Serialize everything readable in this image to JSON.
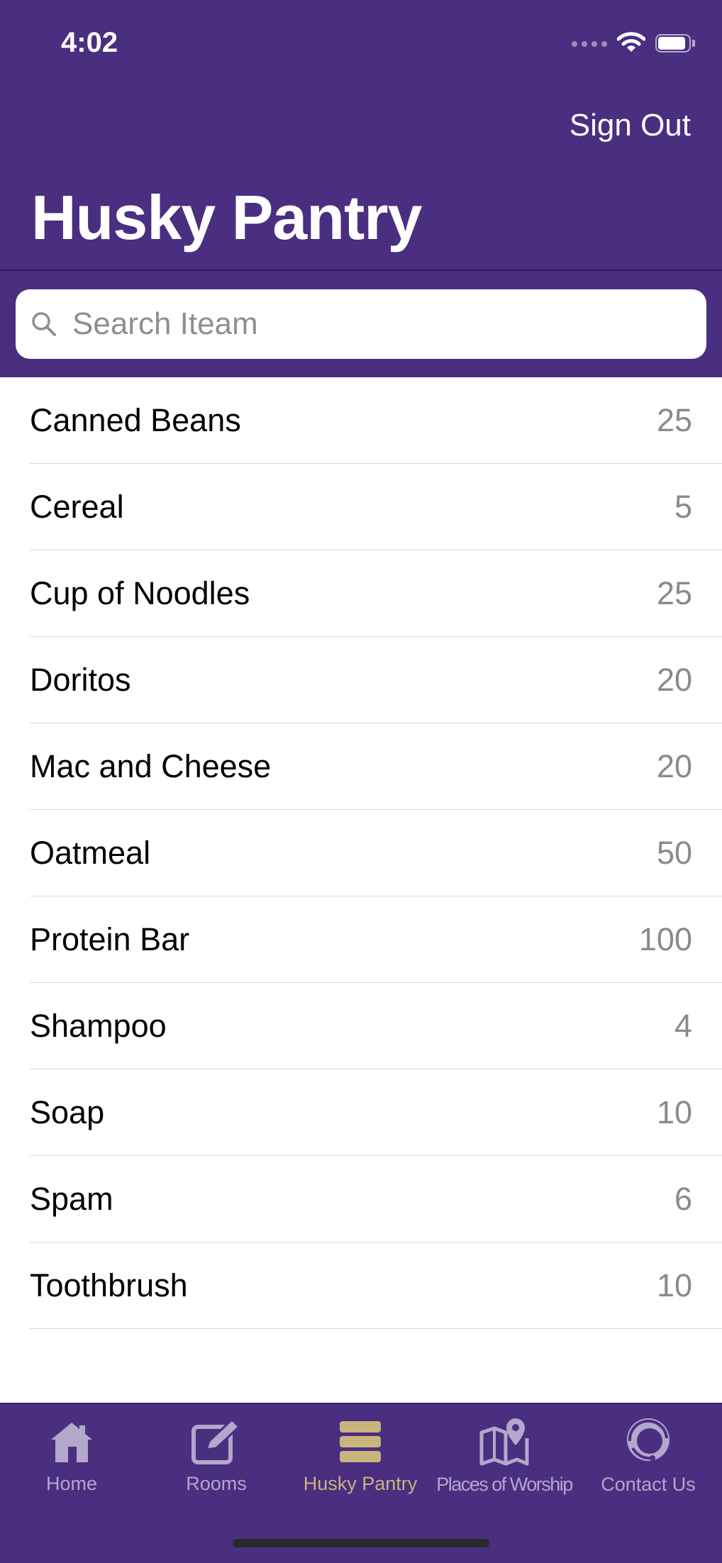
{
  "status_bar": {
    "time": "4:02"
  },
  "nav": {
    "sign_out_label": "Sign Out",
    "title": "Husky Pantry"
  },
  "search": {
    "placeholder": "Search Iteam",
    "value": ""
  },
  "items": [
    {
      "name": "Canned Beans",
      "count": "25"
    },
    {
      "name": "Cereal",
      "count": "5"
    },
    {
      "name": "Cup of Noodles",
      "count": "25"
    },
    {
      "name": "Doritos",
      "count": "20"
    },
    {
      "name": "Mac and Cheese",
      "count": "20"
    },
    {
      "name": "Oatmeal",
      "count": "50"
    },
    {
      "name": "Protein Bar",
      "count": "100"
    },
    {
      "name": "Shampoo",
      "count": "4"
    },
    {
      "name": "Soap",
      "count": "10"
    },
    {
      "name": "Spam",
      "count": "6"
    },
    {
      "name": "Toothbrush",
      "count": "10"
    }
  ],
  "tabbar": {
    "active": "Husky Pantry",
    "tabs": [
      {
        "label": "Home",
        "icon": "house-icon"
      },
      {
        "label": "Rooms",
        "icon": "compose-icon"
      },
      {
        "label": "Husky Pantry",
        "icon": "stack-icon"
      },
      {
        "label": "Places of Worship",
        "icon": "map-pin-icon"
      },
      {
        "label": "Contact Us",
        "icon": "support-agent-icon"
      }
    ]
  },
  "colors": {
    "primary": "#4a2e80",
    "tab_inactive": "#b3a7cc",
    "tab_active": "#c9b47c",
    "count_text": "#8a8a8e"
  }
}
